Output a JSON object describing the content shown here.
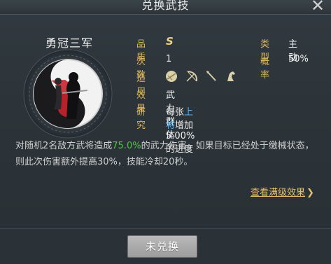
{
  "header": {
    "title": "兑换武技"
  },
  "skill": {
    "name": "勇冠三军",
    "quality_label": "品质",
    "quality_value": "S",
    "count_label": "次数",
    "count_value": "1",
    "applies_label": "适用",
    "applies_icons": [
      "shield-icon",
      "bow-icon",
      "spear-icon",
      "horse-icon"
    ],
    "effect_label": "效果",
    "effect_value": "武力群体",
    "research_label": "研究",
    "research_prefix": "每张",
    "research_highlight": "上将",
    "research_suffix": "增加 5.00% 的进度",
    "type_label": "类型",
    "type_value": "主动",
    "rate_label": "概率",
    "rate_value": "50%"
  },
  "description": {
    "part1": "对随机2名敌方武将造成",
    "pct": "75.0%",
    "part2": "的武力伤害，如果目标已经处于缴械状态，则此次伤害额外提高30%，技能冷却20秒。"
  },
  "link": {
    "label": "查看满级效果",
    "chevron": "❯"
  },
  "footer": {
    "button_label": "未兑换"
  },
  "colors": {
    "label": "#d8b35a",
    "highlight": "#59b7ff",
    "green": "#52c24a",
    "link": "#e3c06a"
  }
}
